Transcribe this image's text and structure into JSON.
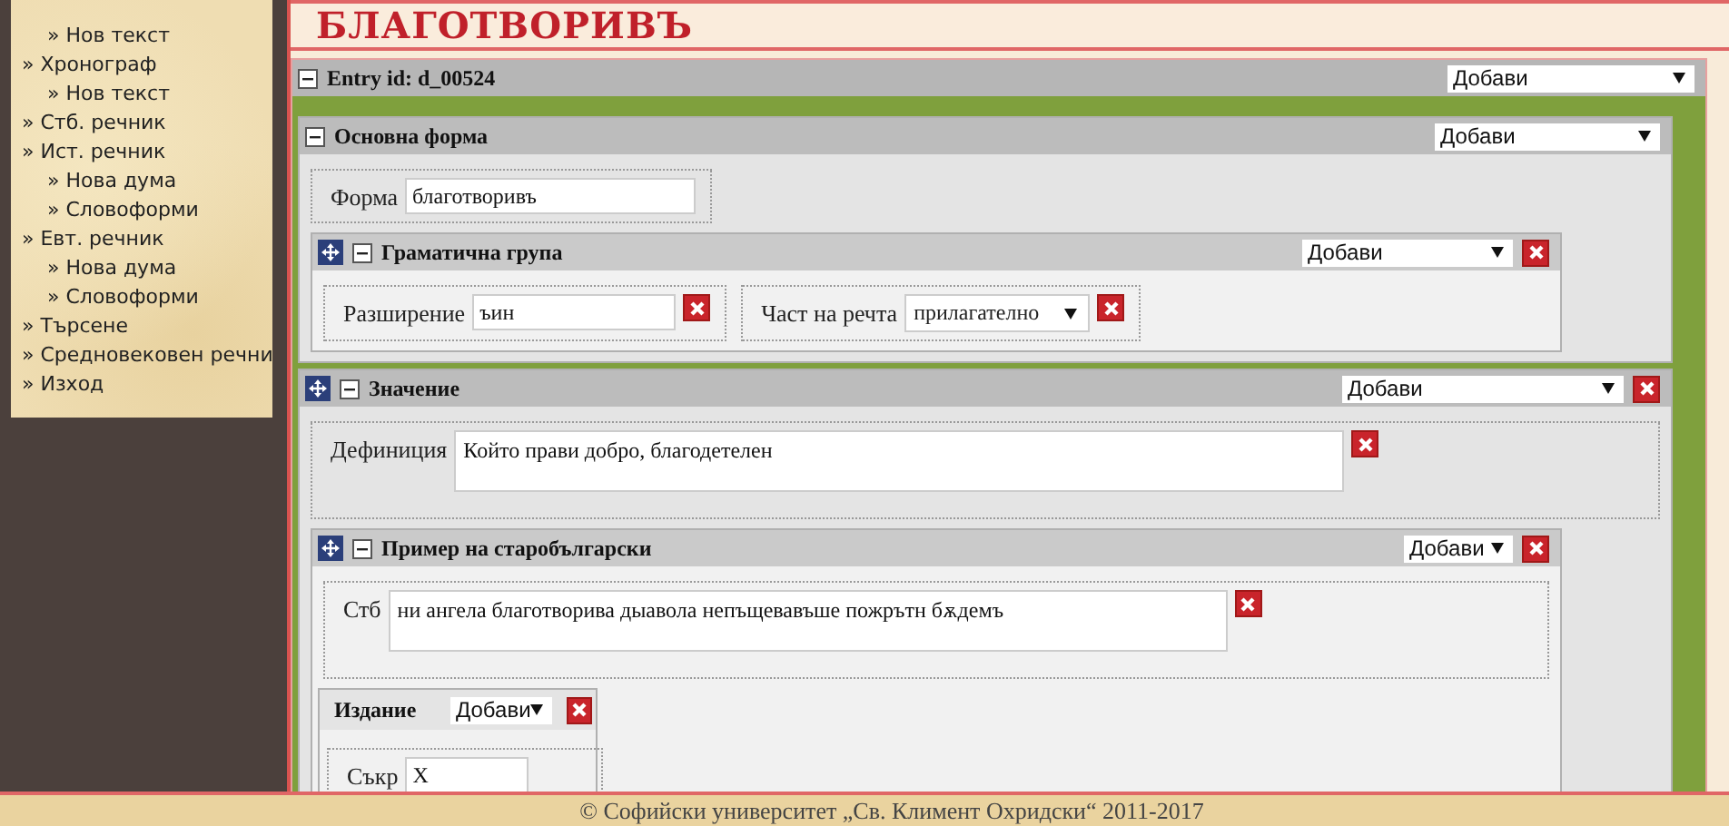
{
  "sidebar": {
    "items": [
      {
        "children": [
          {
            "label": "» Нов текст"
          }
        ]
      },
      {
        "label": "» Хронограф",
        "children": [
          {
            "label": "» Нов текст"
          }
        ]
      },
      {
        "label": "» Стб. речник"
      },
      {
        "label": "» Ист. речник",
        "children": [
          {
            "label": "» Нова дума"
          },
          {
            "label": "» Словоформи"
          }
        ]
      },
      {
        "label": "» Евт. речник",
        "children": [
          {
            "label": "» Нова дума"
          },
          {
            "label": "» Словоформи"
          }
        ]
      },
      {
        "label": "» Търсене"
      },
      {
        "label": "» Средновековен речни"
      },
      {
        "label": "» Изход"
      }
    ]
  },
  "headword": "БЛАГОТВОРИВЪ",
  "entry": {
    "kind": "entry",
    "title": "Entry id: d_00524",
    "collapsible": true,
    "movable": false,
    "removable": false,
    "add_select": "Добави",
    "children": [
      {
        "kind": "section",
        "title": "Основна форма",
        "collapsible": true,
        "movable": false,
        "removable": false,
        "add_select": "Добави",
        "fields": [
          {
            "kind": "text",
            "label": "Форма",
            "value": "благотворивъ",
            "removable": false
          }
        ],
        "children": [
          {
            "kind": "group",
            "title": "Граматична група",
            "collapsible": true,
            "movable": true,
            "removable": true,
            "add_select": "Добави",
            "fields": [
              {
                "kind": "text",
                "label": "Разширение",
                "value": "ъин",
                "removable": true
              },
              {
                "kind": "select",
                "label": "Част на речта",
                "value": "прилагателно",
                "removable": true
              }
            ]
          }
        ]
      },
      {
        "kind": "section",
        "title": "Значение",
        "collapsible": true,
        "movable": true,
        "removable": true,
        "add_select": "Добави",
        "fields": [
          {
            "kind": "textarea",
            "label": "Дефиниция",
            "value": "Който прави добро, благодетелен",
            "removable": true
          }
        ],
        "children": [
          {
            "kind": "group",
            "title": "Пример на старобългарски",
            "collapsible": true,
            "movable": true,
            "removable": true,
            "add_select": "Добави",
            "fields": [
              {
                "kind": "textarea",
                "label": "Стб",
                "value": "ни ангела благотворива дыавола непъщевавъше пожрътн бѫдемъ",
                "removable": true
              }
            ],
            "children": [
              {
                "kind": "compact",
                "title": "Издание",
                "collapsible": false,
                "movable": false,
                "removable": true,
                "add_select": "Добави",
                "fields": [
                  {
                    "kind": "text",
                    "label": "Съкр",
                    "value": "X",
                    "removable": false
                  }
                ]
              }
            ]
          }
        ]
      }
    ]
  },
  "footer": "© Софийски университет „Св. Климент Охридски“ 2011-2017"
}
